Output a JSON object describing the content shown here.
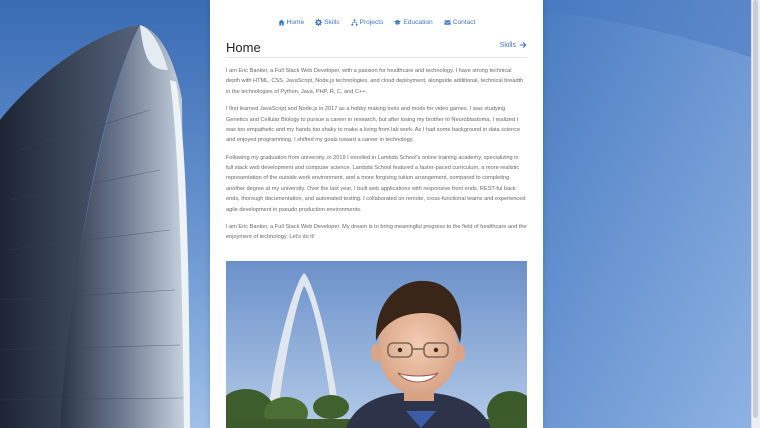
{
  "nav": {
    "items": [
      {
        "label": "Home",
        "icon": "home-icon"
      },
      {
        "label": "Skills",
        "icon": "gear-icon"
      },
      {
        "label": "Projects",
        "icon": "sitemap-icon"
      },
      {
        "label": "Education",
        "icon": "graduation-cap-icon"
      },
      {
        "label": "Contact",
        "icon": "envelope-icon"
      }
    ]
  },
  "page": {
    "title": "Home",
    "next_label": "Skills",
    "next_icon": "arrow-right-icon"
  },
  "paragraphs": [
    "I am Eric Banker, a Full Stack Web Developer, with a passion for healthcare and technology. I have strong technical depth with HTML, CSS, JavaScript, Node.js technologies, and cloud deployment, alongside additional, technical breadth in the technologies of Python, Java, PHP, R, C, and C++.",
    "I first learned JavaScript and Node.js in 2017 as a hobby making tools and mods for video games. I was studying Genetics and Cellular Biology to pursue a career in research, but after losing my brother to Neuroblastoma, I realized I was too empathetic and my hands too shaky to make a living from lab work. As I had some background in data science and enjoyed programming, I shifted my goals toward a career in technology.",
    "Following my graduation from university, in 2019 I enrolled in Lambda School's online training academy, specializing in full stack web development and computer science. Lambda School featured a faster-paced curriculum, a more realistic representation of the outside work environment, and a more forgiving tuition arrangement, compared to completing another degree at my university. Over the last year, I built web applications with responsive front ends, REST-ful back ends, thorough documentation, and automated testing. I collaborated on remote, cross-functional teams and experienced agile development in pseudo production environments.",
    "I am Eric Banker, a Full Stack Web Developer. My dream is to bring meaningful progress to the field of healthcare and the enjoyment of technology. Let's do it!"
  ],
  "colors": {
    "accent": "#3d74c3",
    "text": "#666666",
    "title": "#222222",
    "background_sky": "#5a88c6"
  }
}
